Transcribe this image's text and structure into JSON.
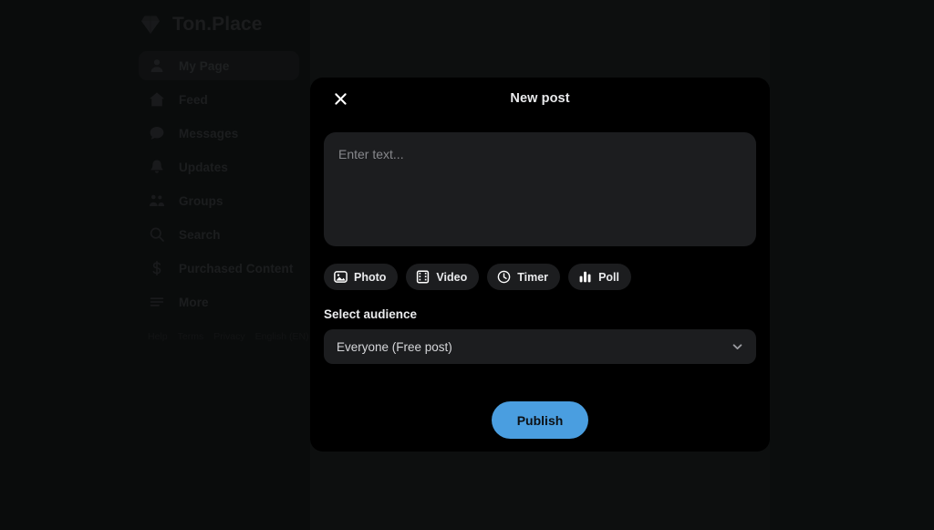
{
  "sidebar": {
    "brand": {
      "name": "Ton.Place",
      "logo_icon": "diamond-icon"
    },
    "items": [
      {
        "label": "My Page",
        "icon": "person-icon",
        "active": true
      },
      {
        "label": "Feed",
        "icon": "home-icon",
        "active": false
      },
      {
        "label": "Messages",
        "icon": "chat-bubble-icon",
        "active": false
      },
      {
        "label": "Updates",
        "icon": "bell-icon",
        "active": false
      },
      {
        "label": "Groups",
        "icon": "people-group-icon",
        "active": false
      },
      {
        "label": "Search",
        "icon": "magnifier-icon",
        "active": false
      },
      {
        "label": "Purchased Content",
        "icon": "dollar-sign-icon",
        "active": false
      },
      {
        "label": "More",
        "icon": "hamburger-menu-icon",
        "active": false
      }
    ],
    "footer_links": [
      "Help",
      "Terms",
      "Privacy",
      "English (EN)"
    ]
  },
  "modal": {
    "title": "New post",
    "close_icon": "close-icon",
    "composer": {
      "value": "",
      "placeholder": "Enter text..."
    },
    "attachments": [
      {
        "label": "Photo",
        "icon": "photo-icon"
      },
      {
        "label": "Video",
        "icon": "video-film-icon"
      },
      {
        "label": "Timer",
        "icon": "clock-icon"
      },
      {
        "label": "Poll",
        "icon": "bar-chart-icon"
      }
    ],
    "audience": {
      "label": "Select audience",
      "selected": "Everyone (Free post)",
      "chevron_icon": "chevron-down-icon"
    },
    "publish_label": "Publish"
  },
  "colors": {
    "accent": "#4A9EE0",
    "modal_bg": "#000000",
    "field_bg": "#1C1D1F",
    "page_bg": "#0F1011"
  }
}
